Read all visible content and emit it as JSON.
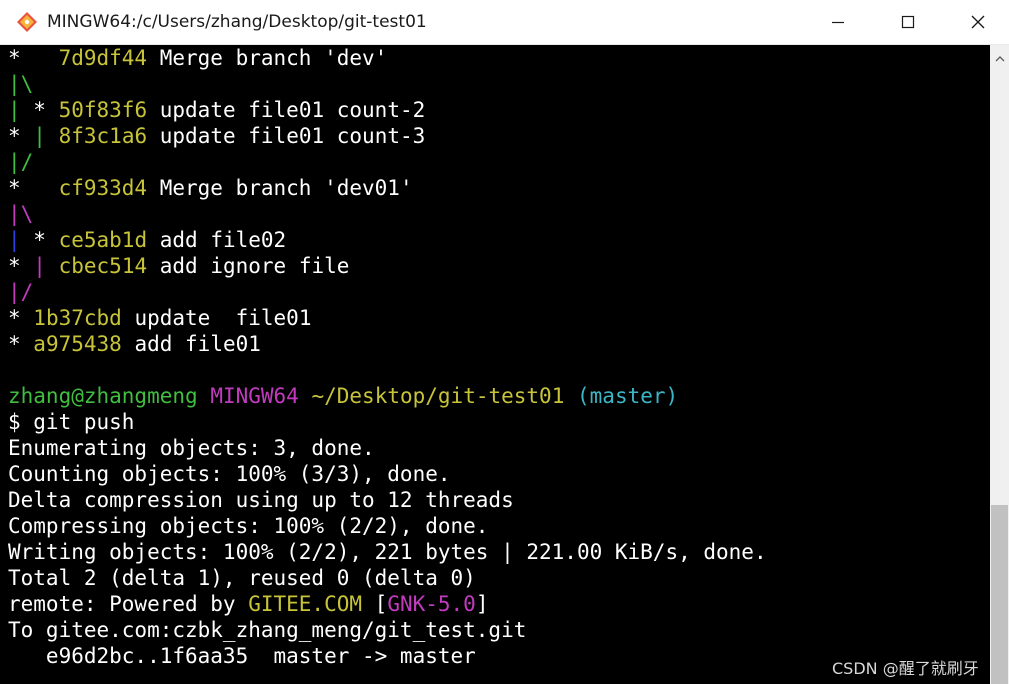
{
  "window": {
    "title": "MINGW64:/c/Users/zhang/Desktop/git-test01",
    "icon": "git-diamond-icon",
    "controls": [
      "minimize-icon",
      "maximize-icon",
      "close-icon"
    ]
  },
  "colors": {
    "background": "#000000",
    "text": "#ffffff",
    "hash": "#c7c43a",
    "user": "#3fbe3f",
    "mingw": "#c23bbf",
    "path": "#c7c43a",
    "branch": "#3ab6c7",
    "graph_green": "#3fbe3f",
    "graph_yellow": "#c7c43a",
    "graph_blue": "#2f3fe0",
    "graph_magenta": "#c23bbf"
  },
  "terminal": {
    "lines": [
      [
        {
          "t": "*   "
        },
        {
          "t": "7d9df44",
          "c": "hash"
        },
        {
          "t": " Merge branch 'dev'"
        }
      ],
      [
        {
          "t": "|\\",
          "c": "graph_green"
        }
      ],
      [
        {
          "t": "|",
          "c": "graph_green"
        },
        {
          "t": " * "
        },
        {
          "t": "50f83f6",
          "c": "hash"
        },
        {
          "t": " update file01 count-2"
        }
      ],
      [
        {
          "t": "* "
        },
        {
          "t": "|",
          "c": "graph_green"
        },
        {
          "t": " "
        },
        {
          "t": "8f3c1a6",
          "c": "hash"
        },
        {
          "t": " update file01 count-3"
        }
      ],
      [
        {
          "t": "|/",
          "c": "graph_green"
        }
      ],
      [
        {
          "t": "*   "
        },
        {
          "t": "cf933d4",
          "c": "hash"
        },
        {
          "t": " Merge branch 'dev01'"
        }
      ],
      [
        {
          "t": "|\\",
          "c": "graph_magenta"
        }
      ],
      [
        {
          "t": "|",
          "c": "graph_blue"
        },
        {
          "t": " * "
        },
        {
          "t": "ce5ab1d",
          "c": "hash"
        },
        {
          "t": " add file02"
        }
      ],
      [
        {
          "t": "* "
        },
        {
          "t": "|",
          "c": "graph_magenta"
        },
        {
          "t": " "
        },
        {
          "t": "cbec514",
          "c": "hash"
        },
        {
          "t": " add ignore file"
        }
      ],
      [
        {
          "t": "|/",
          "c": "graph_magenta"
        }
      ],
      [
        {
          "t": "* "
        },
        {
          "t": "1b37cbd",
          "c": "hash"
        },
        {
          "t": " update  file01"
        }
      ],
      [
        {
          "t": "* "
        },
        {
          "t": "a975438",
          "c": "hash"
        },
        {
          "t": " add file01"
        }
      ],
      [
        {
          "t": ""
        }
      ],
      [
        {
          "t": "zhang@zhangmeng",
          "c": "user"
        },
        {
          "t": " "
        },
        {
          "t": "MINGW64",
          "c": "mingw"
        },
        {
          "t": " "
        },
        {
          "t": "~/Desktop/git-test01",
          "c": "path"
        },
        {
          "t": " "
        },
        {
          "t": "(master)",
          "c": "branch"
        }
      ],
      [
        {
          "t": "$ git push"
        }
      ],
      [
        {
          "t": "Enumerating objects: 3, done."
        }
      ],
      [
        {
          "t": "Counting objects: 100% (3/3), done."
        }
      ],
      [
        {
          "t": "Delta compression using up to 12 threads"
        }
      ],
      [
        {
          "t": "Compressing objects: 100% (2/2), done."
        }
      ],
      [
        {
          "t": "Writing objects: 100% (2/2), 221 bytes | 221.00 KiB/s, done."
        }
      ],
      [
        {
          "t": "Total 2 (delta 1), reused 0 (delta 0)"
        }
      ],
      [
        {
          "t": "remote: Powered by "
        },
        {
          "t": "GITEE.COM",
          "c": "hash"
        },
        {
          "t": " ["
        },
        {
          "t": "GNK-5.0",
          "c": "mingw"
        },
        {
          "t": "]"
        }
      ],
      [
        {
          "t": "To gitee.com:czbk_zhang_meng/git_test.git"
        }
      ],
      [
        {
          "t": "   e96d2bc..1f6aa35  master -> master"
        }
      ]
    ]
  },
  "scrollbar": {
    "up_icon": "scroll-up-arrow-icon"
  },
  "watermark": "CSDN @醒了就刷牙"
}
